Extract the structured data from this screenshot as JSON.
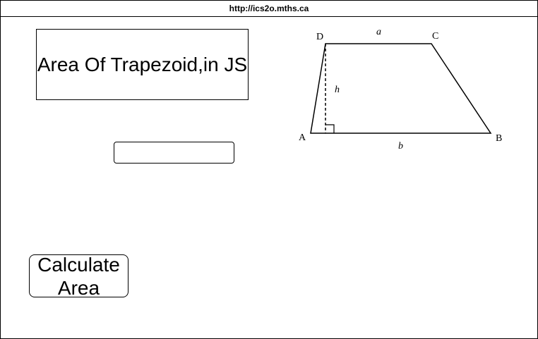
{
  "browser": {
    "url": "http://ics2o.mths.ca"
  },
  "title": "Area Of Trapezoid,in JS",
  "input": {
    "value": "",
    "placeholder": ""
  },
  "calculate_button": {
    "label": "Calculate Area"
  },
  "diagram": {
    "vertex_labels": {
      "A": "A",
      "B": "B",
      "C": "C",
      "D": "D"
    },
    "side_labels": {
      "top": "a",
      "bottom": "b",
      "height": "h"
    }
  }
}
